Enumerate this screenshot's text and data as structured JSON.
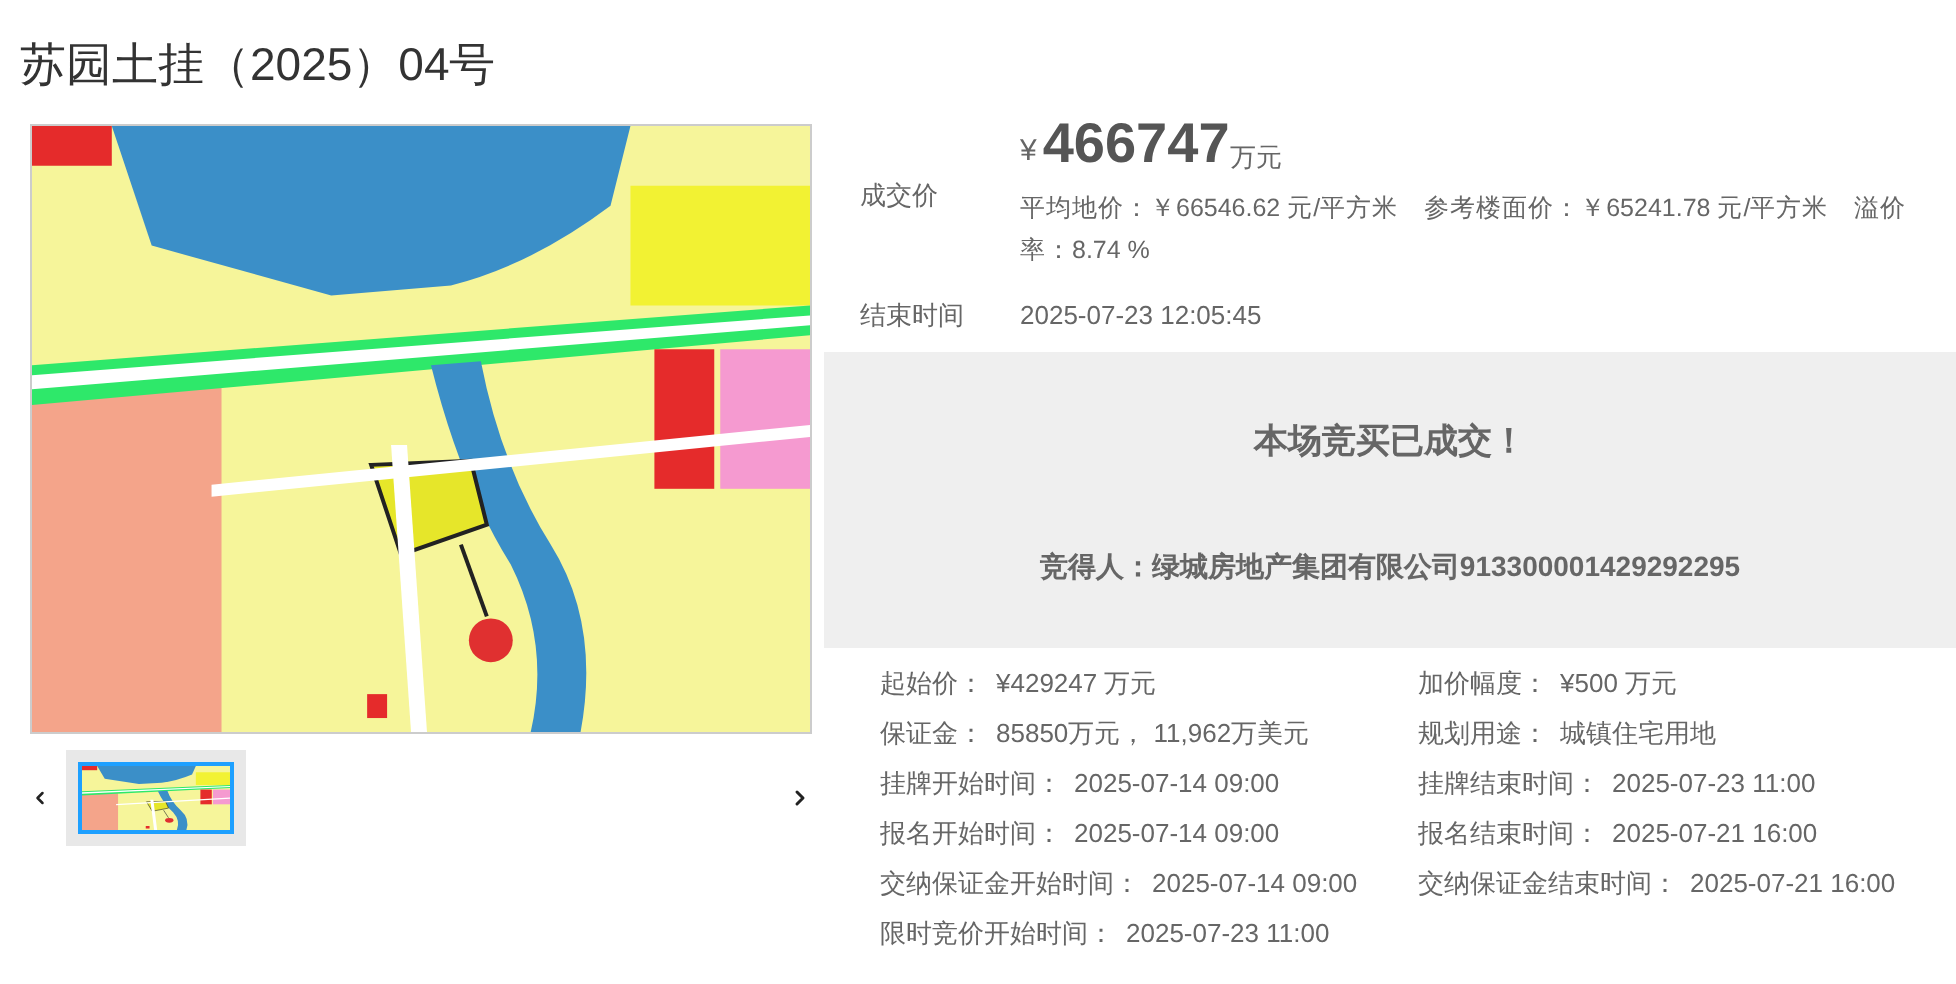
{
  "title": "苏园土挂（2025）04号",
  "gallery": {
    "thumbnails": [
      {
        "selected": true
      }
    ]
  },
  "price": {
    "label": "成交价",
    "currency": "¥",
    "amount": "466747",
    "unit": "万元",
    "details": "平均地价：￥66546.62 元/平方米　参考楼面价：￥65241.78 元/平方米　溢价率：8.74 %"
  },
  "end_time": {
    "label": "结束时间",
    "value": "2025-07-23 12:05:45"
  },
  "result": {
    "status": "本场竞买已成交！",
    "winner": "竞得人：绿城房地产集团有限公司913300001429292295"
  },
  "info": [
    {
      "label": "起始价：",
      "value": "¥429247 万元"
    },
    {
      "label": "加价幅度：",
      "value": "¥500 万元"
    },
    {
      "label": "保证金：",
      "value": "85850万元， 11,962万美元"
    },
    {
      "label": "规划用途：",
      "value": "城镇住宅用地"
    },
    {
      "label": "挂牌开始时间：",
      "value": "2025-07-14 09:00"
    },
    {
      "label": "挂牌结束时间：",
      "value": "2025-07-23 11:00"
    },
    {
      "label": "报名开始时间：",
      "value": "2025-07-14 09:00"
    },
    {
      "label": "报名结束时间：",
      "value": "2025-07-21 16:00"
    },
    {
      "label": "交纳保证金开始时间：",
      "value": "2025-07-14 09:00"
    },
    {
      "label": "交纳保证金结束时间：",
      "value": "2025-07-21 16:00"
    },
    {
      "label": "限时竞价开始时间：",
      "value": "2025-07-23 11:00"
    }
  ]
}
